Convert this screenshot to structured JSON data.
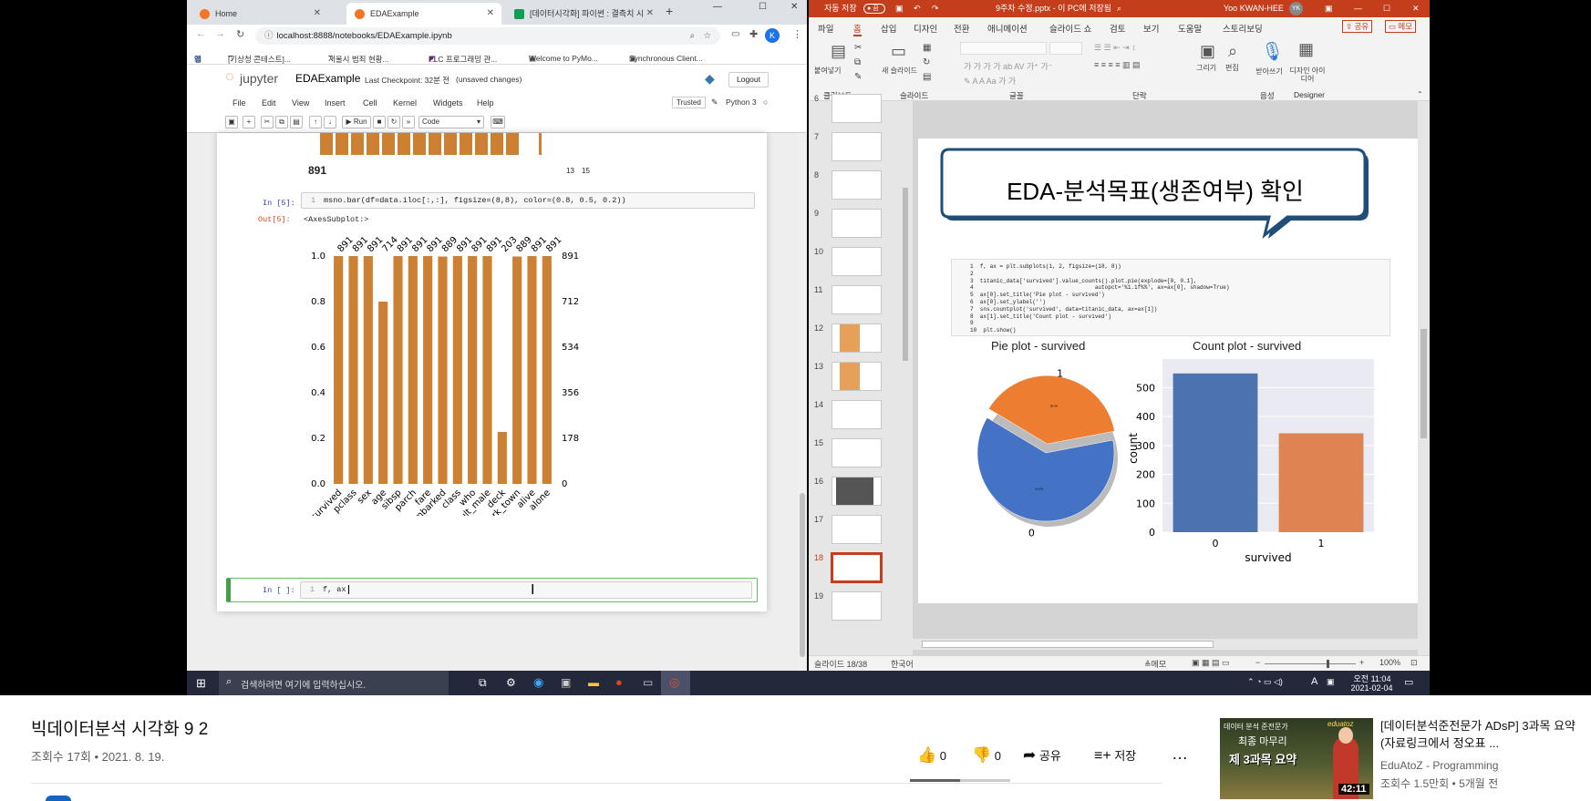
{
  "chrome": {
    "tabs": [
      {
        "label": "Home",
        "icon": "jupyter-icon"
      },
      {
        "label": "EDAExample",
        "icon": "jupyter-icon"
      },
      {
        "label": "[데이터시각화] 파이썬 : 결측치 시",
        "icon": "sheets-icon"
      }
    ],
    "new_tab": "+",
    "window_controls": [
      "—",
      "☐",
      "✕"
    ],
    "url": "localhost:8888/notebooks/EDAExample.ipynb",
    "profile_initial": "K",
    "bookmarks": [
      "앱",
      "[기상청 콘테스트]...",
      "서울시 범죄 현황...",
      "PLC 프로그래밍 관...",
      "Welcome to PyMo...",
      "Synchronous Client..."
    ]
  },
  "jupyter": {
    "logo_text": "jupyter",
    "notebook_name": "EDAExample",
    "checkpoint": "Last Checkpoint: 32분 전",
    "unsaved": "(unsaved changes)",
    "logout": "Logout",
    "menu": [
      "File",
      "Edit",
      "View",
      "Insert",
      "Cell",
      "Kernel",
      "Widgets",
      "Help"
    ],
    "trusted": "Trusted",
    "kernel": "Python 3",
    "run_label": "Run",
    "cell_type": "Code",
    "prev_output_label": "891",
    "prev_output_right": [
      "13",
      "15"
    ],
    "cell5_prompt": "In [5]:",
    "cell5_line": "1",
    "cell5_code": "msno.bar(df=data.iloc[:,:], figsize=(8,8), color=(0.8, 0.5, 0.2))",
    "out5_prompt": "Out[5]:",
    "out5_text": "<AxesSubplot:>",
    "new_cell_prompt": "In [ ]:",
    "new_cell_line": "1",
    "new_cell_code": "f, ax"
  },
  "chart_data": {
    "type": "bar",
    "categories": [
      "survived",
      "pclass",
      "sex",
      "age",
      "sibsp",
      "parch",
      "fare",
      "embarked",
      "class",
      "who",
      "adult_male",
      "deck",
      "embark_town",
      "alive",
      "alone"
    ],
    "values": [
      1.0,
      1.0,
      1.0,
      0.8,
      1.0,
      1.0,
      1.0,
      0.998,
      1.0,
      1.0,
      1.0,
      0.228,
      0.998,
      1.0,
      1.0
    ],
    "top_labels": [
      "891",
      "891",
      "891",
      "714",
      "891",
      "891",
      "891",
      "889",
      "891",
      "891",
      "891",
      "203",
      "889",
      "891",
      "891"
    ],
    "left_ticks": [
      "0.0",
      "0.2",
      "0.4",
      "0.6",
      "0.8",
      "1.0"
    ],
    "right_ticks": [
      "0",
      "178",
      "356",
      "534",
      "712",
      "891"
    ],
    "ylim": [
      0,
      1
    ],
    "color": "#cc8033"
  },
  "ppt": {
    "autosave": "자동 저장",
    "autosave_state": "끔",
    "filename": "9주차 수정.pptx - 이 PC에 저장됨",
    "user": "Yoo KWAN-HEE",
    "user_initials": "YK",
    "tabs": [
      "파일",
      "홈",
      "삽입",
      "디자인",
      "전환",
      "애니메이션",
      "슬라이드 쇼",
      "검토",
      "보기",
      "도움말",
      "스토리보딩"
    ],
    "share": "공유",
    "comment": "메모",
    "ribbon_groups": [
      "클립보드",
      "슬라이드",
      "글꼴",
      "단락",
      "음성",
      "Designer"
    ],
    "ribbon_buttons": [
      "붙여넣기",
      "새 슬라이드",
      "그리기",
      "편집",
      "받아쓰기",
      "디자인 아이디어"
    ],
    "thumb_numbers": [
      "6",
      "7",
      "8",
      "9",
      "10",
      "11",
      "12",
      "13",
      "14",
      "15",
      "16",
      "17",
      "18",
      "19"
    ],
    "current_slide": "18",
    "slide_title": "EDA-분석목표(생존여부) 확인",
    "code_lines": [
      "f, ax = plt.subplots(1, 2, figsize=(18, 8))",
      "",
      "titanic_data['survived'].value_counts().plot.pie(explode=[0, 0.1],",
      "                                   autopct='%1.1f%%', ax=ax[0], shadow=True)",
      "ax[0].set_title('Pie plot - survived')",
      "ax[0].set_ylabel('')",
      "sns.countplot('survived', data=titanic_data, ax=ax[1])",
      "ax[1].set_title('Count plot - survived')",
      "",
      "plt.show()"
    ],
    "pie_title": "Pie plot - survived",
    "pie_labels": [
      "0",
      "1"
    ],
    "pie_values": [
      61.6,
      38.4
    ],
    "pie_pct": [
      "61.6%",
      "38.4%"
    ],
    "count_title": "Count plot - survived",
    "count_xlabel": "survived",
    "count_ylabel": "count",
    "count_categories": [
      "0",
      "1"
    ],
    "count_values": [
      549,
      342
    ],
    "count_ticks": [
      "0",
      "100",
      "200",
      "300",
      "400",
      "500"
    ],
    "status_slide": "슬라이드 18/38",
    "status_lang": "한국어",
    "status_notes": "메모",
    "zoom": "100%",
    "colors": {
      "blue": "#4c72b0",
      "orange": "#dd8452",
      "pie_blue": "#4472c4",
      "pie_orange": "#ed7d31"
    }
  },
  "taskbar": {
    "search_placeholder": "검색하려면 여기에 입력하십시오.",
    "time": "오전 11:04",
    "date": "2021-02-04",
    "ime": "A"
  },
  "youtube": {
    "title": "빅데이터분석 시각화 9 2",
    "meta": "조회수 17회 • 2021. 8. 19.",
    "likes": "0",
    "dislikes": "0",
    "share": "공유",
    "save": "저장",
    "more": "…",
    "rec_title": "[데이터분석준전문가 ADsP] 3과목 요약 (자료링크에서 정오표 ...",
    "rec_channel": "EduAtoZ - Programming",
    "rec_meta": "조회수 1.5만회 • 5개월 전",
    "rec_duration": "42:11",
    "rec_thumb_text": [
      "데이터 분석 준전문가",
      "최종 마무리",
      "제 3과목 요약"
    ],
    "rec_thumb_brand": "eduatoz"
  }
}
